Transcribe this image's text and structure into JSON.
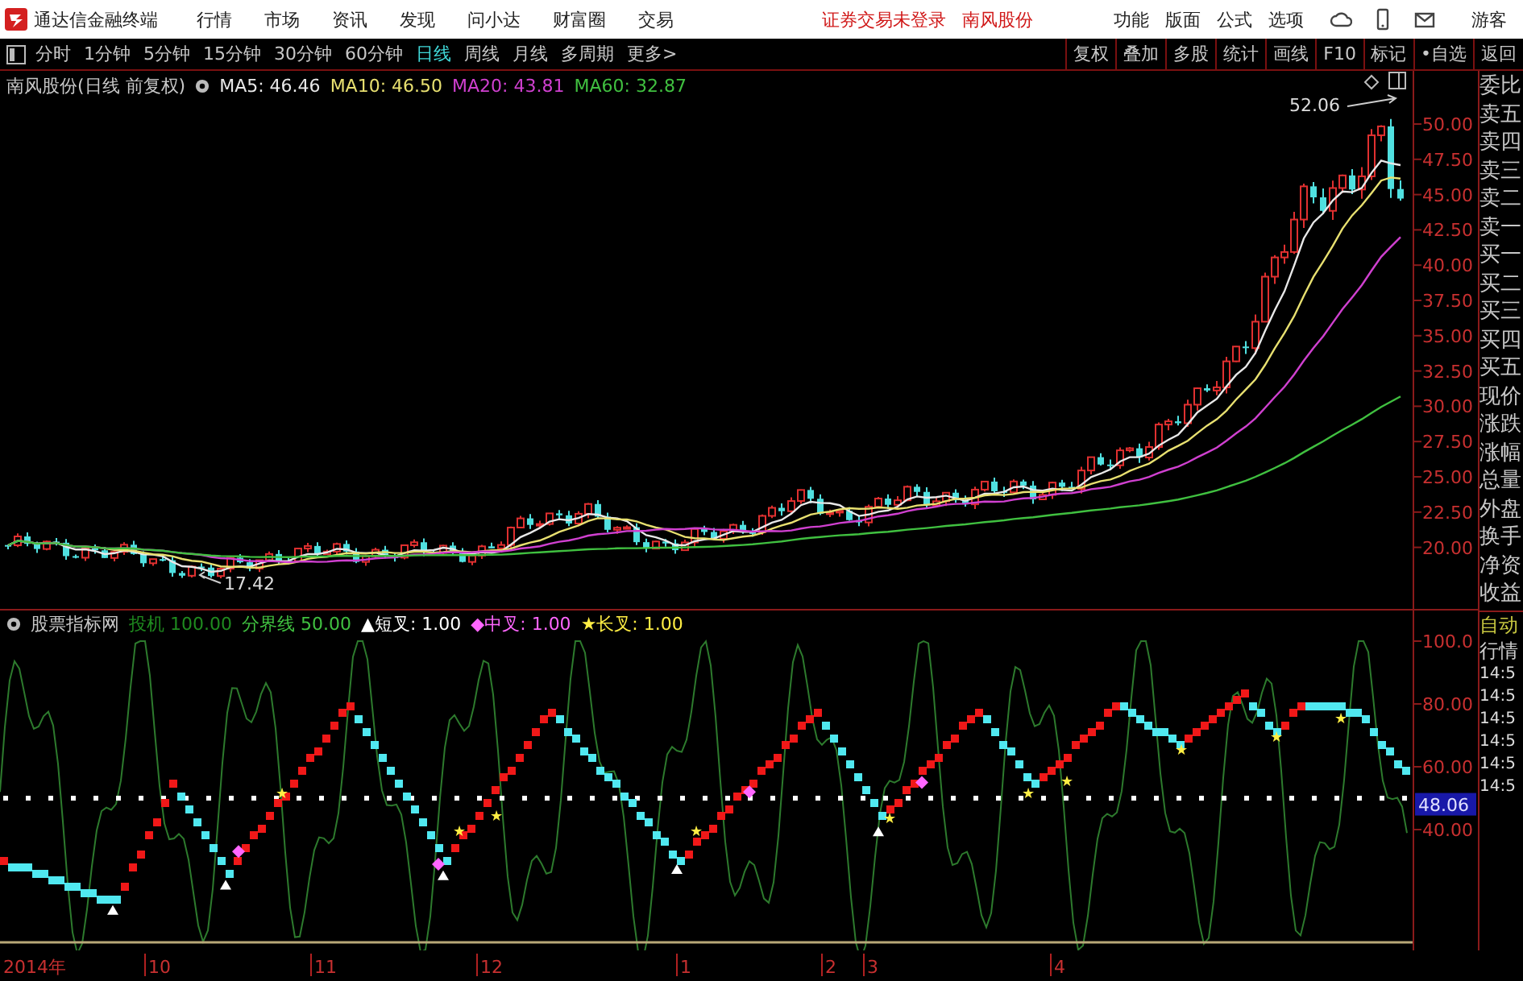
{
  "title_bar": {
    "app_name": "通达信金融终端",
    "menu": [
      "行情",
      "市场",
      "资讯",
      "发现",
      "问小达",
      "财富圈",
      "交易"
    ],
    "notices": [
      "证券交易未登录",
      "南风股份"
    ],
    "tools": [
      "功能",
      "版面",
      "公式",
      "选项"
    ],
    "user": "游客"
  },
  "period_bar": {
    "periods": [
      {
        "label": "分时",
        "selected": false
      },
      {
        "label": "1分钟",
        "selected": false
      },
      {
        "label": "5分钟",
        "selected": false
      },
      {
        "label": "15分钟",
        "selected": false
      },
      {
        "label": "30分钟",
        "selected": false
      },
      {
        "label": "60分钟",
        "selected": false
      },
      {
        "label": "日线",
        "selected": true
      },
      {
        "label": "周线",
        "selected": false
      },
      {
        "label": "月线",
        "selected": false
      },
      {
        "label": "多周期",
        "selected": false
      },
      {
        "label": "更多>",
        "selected": false
      }
    ],
    "actions": [
      "复权",
      "叠加",
      "多股",
      "统计",
      "画线",
      "F10",
      "标记",
      "•自选",
      "返回"
    ]
  },
  "price_chart": {
    "title": "南风股份(日线 前复权)",
    "ma": [
      {
        "label": "MA5: 46.46",
        "color": "#e8e8e8"
      },
      {
        "label": "MA10: 46.50",
        "color": "#e8e070"
      },
      {
        "label": "MA20: 43.81",
        "color": "#d040d0"
      },
      {
        "label": "MA60: 32.87",
        "color": "#40c040"
      }
    ],
    "high_label": "52.06",
    "low_label": "17.42",
    "y_ticks": [
      "50.00",
      "47.50",
      "45.00",
      "42.50",
      "40.00",
      "37.50",
      "35.00",
      "32.50",
      "30.00",
      "27.50",
      "25.00",
      "22.50",
      "20.00"
    ]
  },
  "indicator": {
    "name": "股票指标网",
    "params": [
      {
        "label": "投机",
        "value": "100.00",
        "color": "#1f8a1f"
      },
      {
        "label": "分界线",
        "value": "50.00",
        "color": "#40c040"
      }
    ],
    "signals": [
      {
        "symbol": "▲",
        "label": "短叉: 1.00",
        "color": "#ffffff"
      },
      {
        "symbol": "◆",
        "label": "中叉: 1.00",
        "color": "#ff66ff"
      },
      {
        "symbol": "★",
        "label": "长叉: 1.00",
        "color": "#ffee44"
      }
    ],
    "y_ticks": [
      "100.0",
      "80.00",
      "60.00",
      "40.00"
    ],
    "reading": "48.06"
  },
  "date_axis": [
    "2014年",
    "10",
    "11",
    "12",
    "1",
    "2",
    "3",
    "4"
  ],
  "quote_panel": {
    "labels": [
      "委比",
      "卖五",
      "卖四",
      "卖三",
      "卖二",
      "卖一",
      "买一",
      "买二",
      "买三",
      "买四",
      "买五",
      "现价",
      "涨跌",
      "涨幅",
      "总量",
      "外盘",
      "换手",
      "净资",
      "收益"
    ],
    "mode": [
      "自动",
      "行情"
    ],
    "times": [
      "14:5",
      "14:5",
      "14:5",
      "14:5",
      "14:5",
      "14:5"
    ]
  }
}
